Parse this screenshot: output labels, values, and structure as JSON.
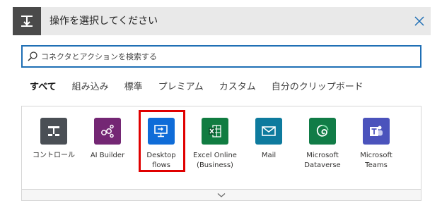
{
  "header": {
    "title": "操作を選択してください",
    "icon": "flow-step-icon",
    "close_icon": "close-icon",
    "colors": {
      "bar": "#e9e9e9",
      "icon_bg": "#4a4a4a",
      "close": "#1f6fb5"
    }
  },
  "search": {
    "placeholder": "コネクタとアクションを検索する",
    "value": ""
  },
  "tabs": [
    {
      "label": "すべて",
      "active": true
    },
    {
      "label": "組み込み",
      "active": false
    },
    {
      "label": "標準",
      "active": false
    },
    {
      "label": "プレミアム",
      "active": false
    },
    {
      "label": "カスタム",
      "active": false
    },
    {
      "label": "自分のクリップボード",
      "active": false
    }
  ],
  "connectors": [
    {
      "label": "コントロール",
      "icon": "control-icon",
      "color": "#4a4f55"
    },
    {
      "label": "AI Builder",
      "icon": "ai-builder-icon",
      "color": "#742774"
    },
    {
      "label": "Desktop flows",
      "icon": "desktop-flows-icon",
      "color": "#0f6cd8"
    },
    {
      "label": "Excel Online (Business)",
      "icon": "excel-icon",
      "color": "#107c41"
    },
    {
      "label": "Mail",
      "icon": "mail-icon",
      "color": "#0e7b9e"
    },
    {
      "label": "Microsoft Dataverse",
      "icon": "dataverse-icon",
      "color": "#117c47"
    },
    {
      "label": "Microsoft Teams",
      "icon": "teams-icon",
      "color": "#4b53bc"
    }
  ],
  "highlight_color": "#e00000",
  "footer_icon": "chevron-down-icon"
}
